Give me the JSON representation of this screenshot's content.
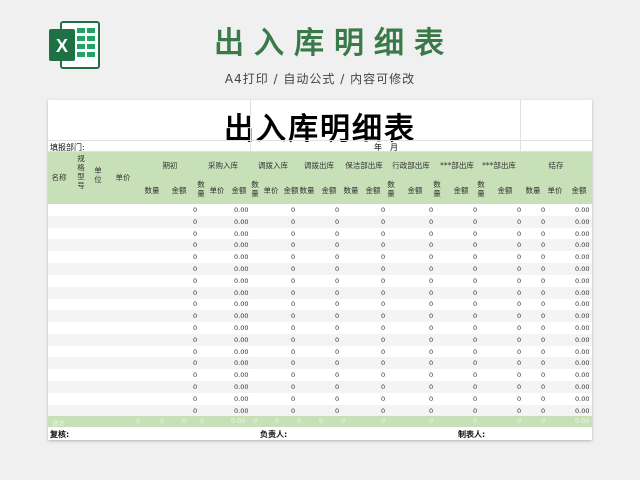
{
  "promo": {
    "title": "出入库明细表",
    "subtitle": "A4打印 / 自动公式 / 内容可修改"
  },
  "sheet": {
    "title": "出入库明细表",
    "dept_label": "填报部门:",
    "year_label": "年",
    "month_label": "月",
    "header": {
      "name": "名称",
      "spec": "规格型号",
      "unit": "单位",
      "price": "单价",
      "groups": [
        "期初",
        "采购入库",
        "调拨入库",
        "调拨出库",
        "保洁部出库",
        "行政部出库",
        "***部出库",
        "***部出库",
        "结存"
      ],
      "qty": "数量",
      "price_sub": "单价",
      "amount": "金额"
    },
    "rows": [
      {
        "qty": "0",
        "amount": "0.00",
        "v1": "0",
        "v2": "0",
        "v3": "0",
        "v4": "0",
        "v5": "0",
        "v6": "0",
        "v7": "0",
        "end": "0.00"
      },
      {
        "qty": "0",
        "amount": "0.00",
        "v1": "0",
        "v2": "0",
        "v3": "0",
        "v4": "0",
        "v5": "0",
        "v6": "0",
        "v7": "0",
        "end": "0.00"
      },
      {
        "qty": "0",
        "amount": "0.00",
        "v1": "0",
        "v2": "0",
        "v3": "0",
        "v4": "0",
        "v5": "0",
        "v6": "0",
        "v7": "0",
        "end": "0.00"
      },
      {
        "qty": "0",
        "amount": "0.00",
        "v1": "0",
        "v2": "0",
        "v3": "0",
        "v4": "0",
        "v5": "0",
        "v6": "0",
        "v7": "0",
        "end": "0.00"
      },
      {
        "qty": "0",
        "amount": "0.00",
        "v1": "0",
        "v2": "0",
        "v3": "0",
        "v4": "0",
        "v5": "0",
        "v6": "0",
        "v7": "0",
        "end": "0.00"
      },
      {
        "qty": "0",
        "amount": "0.00",
        "v1": "0",
        "v2": "0",
        "v3": "0",
        "v4": "0",
        "v5": "0",
        "v6": "0",
        "v7": "0",
        "end": "0.00"
      },
      {
        "qty": "0",
        "amount": "0.00",
        "v1": "0",
        "v2": "0",
        "v3": "0",
        "v4": "0",
        "v5": "0",
        "v6": "0",
        "v7": "0",
        "end": "0.00"
      },
      {
        "qty": "0",
        "amount": "0.00",
        "v1": "0",
        "v2": "0",
        "v3": "0",
        "v4": "0",
        "v5": "0",
        "v6": "0",
        "v7": "0",
        "end": "0.00"
      },
      {
        "qty": "0",
        "amount": "0.00",
        "v1": "0",
        "v2": "0",
        "v3": "0",
        "v4": "0",
        "v5": "0",
        "v6": "0",
        "v7": "0",
        "end": "0.00"
      },
      {
        "qty": "0",
        "amount": "0.00",
        "v1": "0",
        "v2": "0",
        "v3": "0",
        "v4": "0",
        "v5": "0",
        "v6": "0",
        "v7": "0",
        "end": "0.00"
      },
      {
        "qty": "0",
        "amount": "0.00",
        "v1": "0",
        "v2": "0",
        "v3": "0",
        "v4": "0",
        "v5": "0",
        "v6": "0",
        "v7": "0",
        "end": "0.00"
      },
      {
        "qty": "0",
        "amount": "0.00",
        "v1": "0",
        "v2": "0",
        "v3": "0",
        "v4": "0",
        "v5": "0",
        "v6": "0",
        "v7": "0",
        "end": "0.00"
      },
      {
        "qty": "0",
        "amount": "0.00",
        "v1": "0",
        "v2": "0",
        "v3": "0",
        "v4": "0",
        "v5": "0",
        "v6": "0",
        "v7": "0",
        "end": "0.00"
      },
      {
        "qty": "0",
        "amount": "0.00",
        "v1": "0",
        "v2": "0",
        "v3": "0",
        "v4": "0",
        "v5": "0",
        "v6": "0",
        "v7": "0",
        "end": "0.00"
      },
      {
        "qty": "0",
        "amount": "0.00",
        "v1": "0",
        "v2": "0",
        "v3": "0",
        "v4": "0",
        "v5": "0",
        "v6": "0",
        "v7": "0",
        "end": "0.00"
      },
      {
        "qty": "0",
        "amount": "0.00",
        "v1": "0",
        "v2": "0",
        "v3": "0",
        "v4": "0",
        "v5": "0",
        "v6": "0",
        "v7": "0",
        "end": "0.00"
      },
      {
        "qty": "0",
        "amount": "0.00",
        "v1": "0",
        "v2": "0",
        "v3": "0",
        "v4": "0",
        "v5": "0",
        "v6": "0",
        "v7": "0",
        "end": "0.00"
      },
      {
        "qty": "0",
        "amount": "0.00",
        "v1": "0",
        "v2": "0",
        "v3": "0",
        "v4": "0",
        "v5": "0",
        "v6": "0",
        "v7": "0",
        "end": "0.00"
      }
    ],
    "total": {
      "label": "合计",
      "values": [
        "0",
        "0",
        "0",
        "0",
        "0.00",
        "0",
        "0",
        "0",
        "0",
        "0",
        "0",
        "0",
        "0",
        "0",
        "0",
        "0.00"
      ]
    },
    "footer": {
      "reviewer": "复核:",
      "manager": "负责人:",
      "preparer": "制表人:"
    }
  },
  "colors": {
    "brand_green": "#3a7a48",
    "header_green": "#c8e0b8",
    "excel_green": "#1e7145"
  },
  "icons": [
    "excel-logo-icon"
  ]
}
